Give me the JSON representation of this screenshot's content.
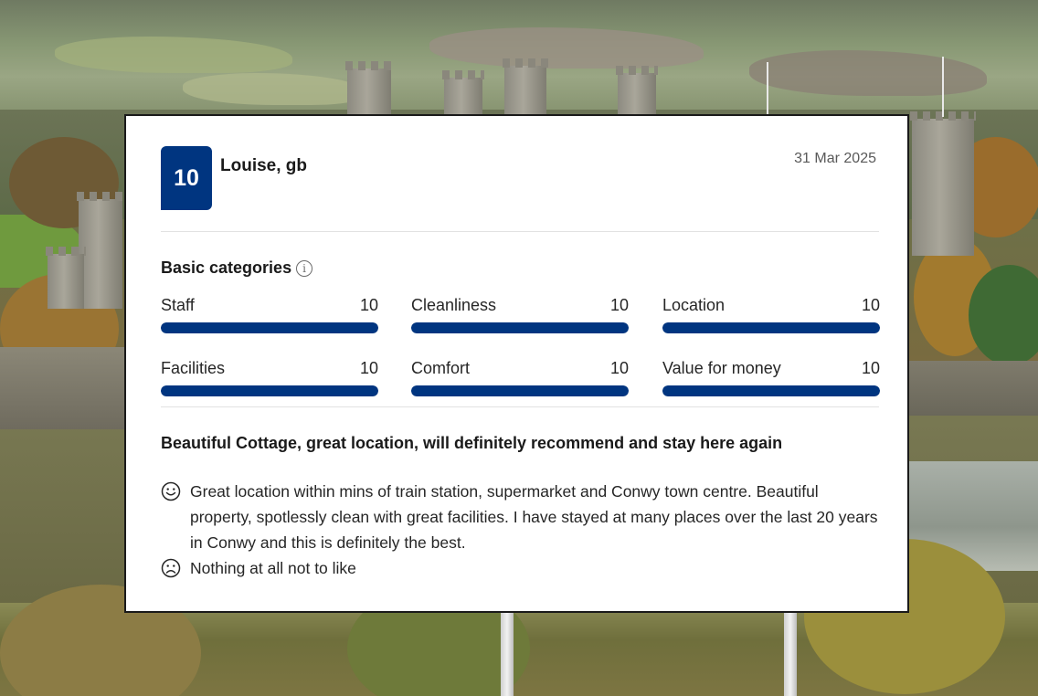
{
  "review": {
    "score": "10",
    "reviewer": "Louise, gb",
    "date": "31 Mar 2025",
    "categories_title": "Basic categories",
    "categories": [
      {
        "label": "Staff",
        "score": "10",
        "fill": 1.0
      },
      {
        "label": "Cleanliness",
        "score": "10",
        "fill": 1.0
      },
      {
        "label": "Location",
        "score": "10",
        "fill": 1.0
      },
      {
        "label": "Facilities",
        "score": "10",
        "fill": 1.0
      },
      {
        "label": "Comfort",
        "score": "10",
        "fill": 1.0
      },
      {
        "label": "Value for money",
        "score": "10",
        "fill": 1.0
      }
    ],
    "headline": "Beautiful Cottage, great location, will definitely recommend and stay here again",
    "liked": "Great location within mins of train station, supermarket and Conwy town centre. Beautiful property, spotlessly clean with great facilities. I have stayed at many places over the last 20 years in Conwy and this is definitely the best.",
    "disliked": "Nothing at all not to like"
  },
  "icons": {
    "info": "info-icon",
    "liked": "smile-icon",
    "disliked": "frown-icon"
  },
  "colors": {
    "brand_blue": "#003580",
    "bar_track": "#e6e6e6"
  }
}
